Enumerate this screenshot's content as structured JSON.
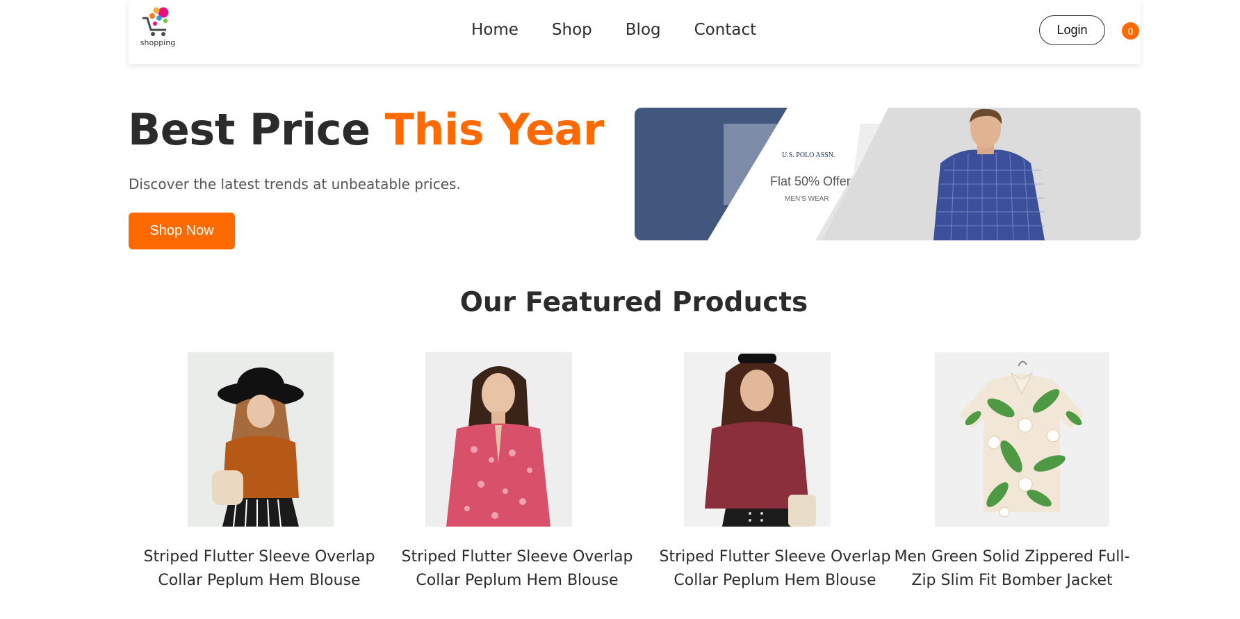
{
  "header": {
    "logo_text": "shopping",
    "nav": [
      "Home",
      "Shop",
      "Blog",
      "Contact"
    ],
    "login_label": "Login",
    "cart_count": "0"
  },
  "hero": {
    "title_main": "Best Price ",
    "title_accent": "This Year",
    "subtitle": "Discover the latest trends at unbeatable prices.",
    "cta_label": "Shop Now"
  },
  "banner": {
    "brand": "U.S. POLO ASSN.",
    "offer": "Flat 50% Offer",
    "sub": "MEN'S WEAR"
  },
  "featured": {
    "title": "Our Featured Products",
    "products": [
      {
        "name": "Striped Flutter Sleeve Overlap Collar Peplum Hem Blouse"
      },
      {
        "name": "Striped Flutter Sleeve Overlap Collar Peplum Hem Blouse"
      },
      {
        "name": "Striped Flutter Sleeve Overlap Collar Peplum Hem Blouse"
      },
      {
        "name": "Men Green Solid Zippered Full-Zip Slim Fit Bomber Jacket"
      }
    ]
  },
  "colors": {
    "accent": "#ff6a00",
    "text": "#2b2b2b"
  }
}
